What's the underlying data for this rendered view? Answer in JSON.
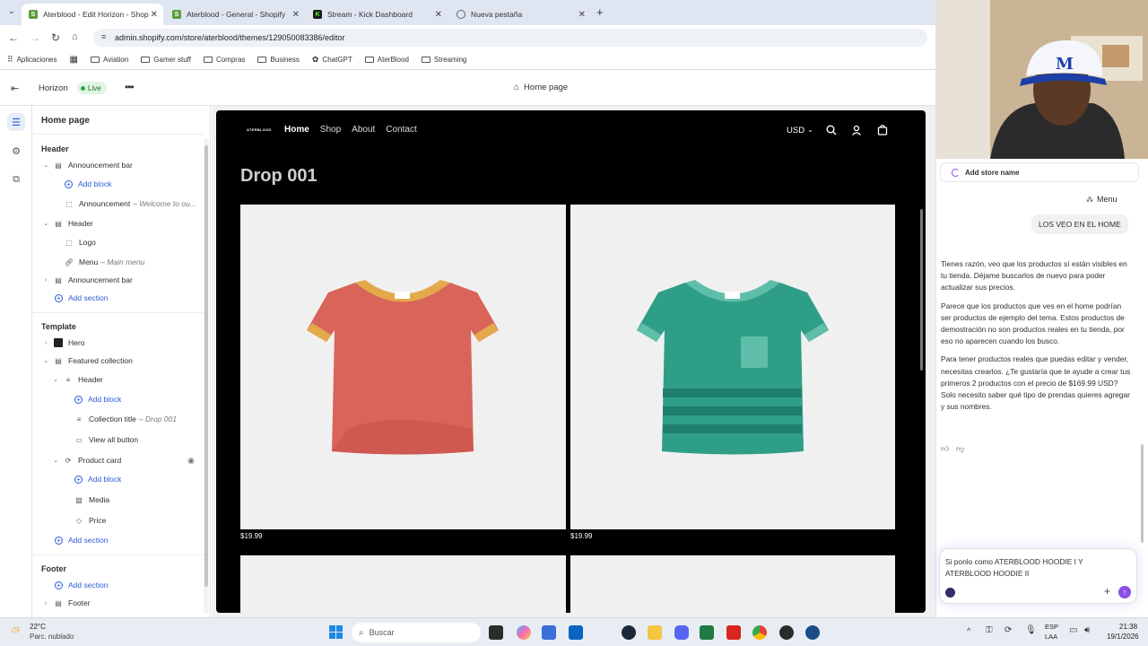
{
  "browser": {
    "tabs": [
      {
        "title": "Aterblood - Edit Horizon - Shop",
        "active": true,
        "favicon_color": "#5a9e3a"
      },
      {
        "title": "Aterblood - General - Shopify",
        "active": false,
        "favicon_color": "#5a9e3a"
      },
      {
        "title": "Stream - Kick Dashboard",
        "active": false,
        "favicon_color": "#1a1a1a"
      },
      {
        "title": "Nueva pestaña",
        "active": false,
        "favicon_color": "#777777"
      }
    ],
    "url": "admin.shopify.com/store/aterblood/themes/129050083386/editor",
    "bookmarks": [
      "Aplicaciones",
      "Aviation",
      "Gamer stuff",
      "Compras",
      "Business",
      "ChatGPT",
      "AterBlood",
      "Streaming"
    ]
  },
  "editor": {
    "theme_name": "Horizon",
    "live_badge": "Live",
    "page_selector": "Home page",
    "sidebar_title": "Home page",
    "header_section_label": "Header",
    "header_items": [
      {
        "label": "Announcement bar",
        "sub": ""
      },
      {
        "label": "Add block",
        "sub": ""
      },
      {
        "label": "Announcement",
        "sub": "– Welcome to ou..."
      },
      {
        "label": "Header",
        "sub": ""
      },
      {
        "label": "Logo",
        "sub": ""
      },
      {
        "label": "Menu",
        "sub": "– Main menu"
      },
      {
        "label": "Announcement bar",
        "sub": ""
      },
      {
        "label": "Add section",
        "sub": ""
      }
    ],
    "template_label": "Template",
    "template_items": [
      {
        "label": "Hero",
        "sub": ""
      },
      {
        "label": "Featured collection",
        "sub": ""
      },
      {
        "label": "Header",
        "sub": ""
      },
      {
        "label": "Add block",
        "sub": ""
      },
      {
        "label": "Collection title",
        "sub": "– Drop 001"
      },
      {
        "label": "View all button",
        "sub": ""
      },
      {
        "label": "Product card",
        "sub": ""
      },
      {
        "label": "Add block",
        "sub": ""
      },
      {
        "label": "Media",
        "sub": ""
      },
      {
        "label": "Price",
        "sub": ""
      },
      {
        "label": "Add section",
        "sub": ""
      }
    ],
    "footer_label": "Footer",
    "footer_items": [
      {
        "label": "Add section",
        "sub": ""
      },
      {
        "label": "Footer",
        "sub": ""
      }
    ]
  },
  "store": {
    "logo": "ATERBLOOD",
    "nav": [
      "Home",
      "Shop",
      "About",
      "Contact"
    ],
    "currency": "USD",
    "collection_title": "Drop 001",
    "products": [
      {
        "price": "$19.99",
        "shirt_color": "#d9645a",
        "accent": "#e3a94b"
      },
      {
        "price": "$19.99",
        "shirt_color": "#2e9e87",
        "accent": "#5fbea9"
      }
    ]
  },
  "chat": {
    "top_item": "Add store name",
    "menu_label": "Menu",
    "user_message": "LOS VEO EN EL HOME",
    "reply_paragraphs": [
      "Tienes razón, veo que los productos sí están visibles en tu tienda. Déjame buscarlos de nuevo para poder actualizar sus precios.",
      "Parece que los productos que ves en el home podrían ser productos de ejemplo del tema. Estos productos de demostración no son productos reales en tu tienda, por eso no aparecen cuando los busco.",
      "Para tener productos reales que puedas editar y vender, necesitas crearlos. ¿Te gustaría que te ayude a crear tus primeros 2 productos con el precio de $169.99 USD? Solo necesito saber qué tipo de prendas quieres agregar y sus nombres."
    ],
    "input_text": "Si ponlo como ATERBLOOD HOODIE I Y ATERBLOOD HOODIE II"
  },
  "taskbar": {
    "temperature": "22°C",
    "weather": "Parc. nublado",
    "search_placeholder": "Buscar",
    "language": "ESP",
    "layout": "LAA",
    "time": "21:38",
    "date": "19/1/2026"
  }
}
